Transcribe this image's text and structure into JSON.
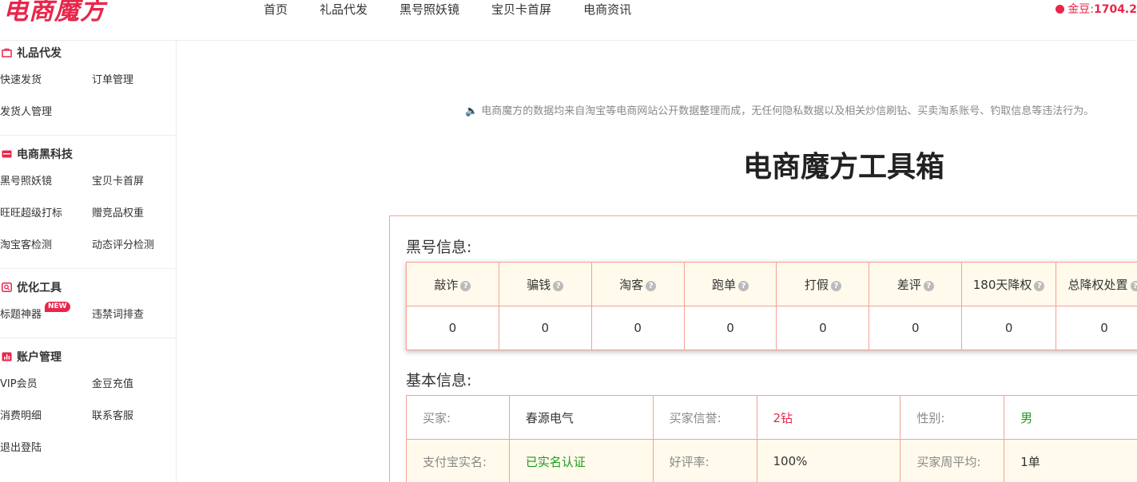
{
  "header": {
    "logo": "电商魔方",
    "nav": [
      "首页",
      "礼品代发",
      "黑号照妖镜",
      "宝贝卡首屏",
      "电商资讯"
    ],
    "coin_label": "金豆:",
    "coin_value": "1704.2"
  },
  "sidebar": {
    "sections": [
      {
        "title": "礼品代发",
        "icon": "bag-icon",
        "items": [
          "快速发货",
          "订单管理",
          "发货人管理"
        ]
      },
      {
        "title": "电商黑科技",
        "icon": "card-icon",
        "items": [
          "黑号照妖镜",
          "宝贝卡首屏",
          "旺旺超级打标",
          "赠竞品权重",
          "淘宝客检测",
          "动态评分检测"
        ]
      },
      {
        "title": "优化工具",
        "icon": "search-doc-icon",
        "items": [
          "标题神器",
          "违禁词排查"
        ],
        "badge": "NEW"
      },
      {
        "title": "账户管理",
        "icon": "chart-icon",
        "items": [
          "VIP会员",
          "金豆充值",
          "消费明细",
          "联系客服",
          "退出登陆"
        ]
      }
    ]
  },
  "main": {
    "notice": "电商魔方的数据均来自淘宝等电商网站公开数据整理而成，无任何隐私数据以及相关炒信刷钻、买卖淘系账号、钓取信息等违法行为。",
    "title": "电商魔方工具箱",
    "blacklist": {
      "heading": "黑号信息:",
      "headers": [
        "敲诈",
        "骗钱",
        "淘客",
        "跑单",
        "打假",
        "差评",
        "180天降权",
        "总降权处置"
      ],
      "values": [
        "0",
        "0",
        "0",
        "0",
        "0",
        "0",
        "0",
        "0"
      ]
    },
    "basic": {
      "heading": "基本信息:",
      "rows": [
        [
          {
            "label": "买家:",
            "value": "春源电气"
          },
          {
            "label": "买家信誉:",
            "value": "2钻"
          },
          {
            "label": "性别:",
            "value": "男"
          }
        ],
        [
          {
            "label": "支付宝实名:",
            "value": "已实名认证"
          },
          {
            "label": "好评率:",
            "value": "100%"
          },
          {
            "label": "买家周平均:",
            "value": "1单"
          }
        ]
      ]
    }
  },
  "colors": {
    "accent": "#e8264b",
    "border": "#f5a193",
    "header_bg": "#fffaeb",
    "green": "#1e9a1e"
  }
}
